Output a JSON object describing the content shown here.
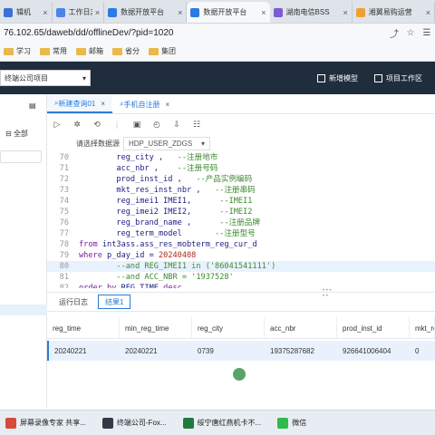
{
  "browser": {
    "tabs": [
      {
        "label": "辑机",
        "color": "#3a6fd8",
        "active": false
      },
      {
        "label": "工作日志",
        "color": "#4a86e8",
        "active": false
      },
      {
        "label": "数据开放平台",
        "color": "#2c7be5",
        "active": false
      },
      {
        "label": "数据开放平台",
        "color": "#2c7be5",
        "active": true
      },
      {
        "label": "湖南电信BSS",
        "color": "#7b5cd6",
        "active": false
      },
      {
        "label": "湘翼易购运营",
        "color": "#f0a030",
        "active": false
      }
    ],
    "address": "76.102.65/daweb/dd/offlineDev/?pid=1020",
    "bookmarks": [
      "学习",
      "常用",
      "邮箱",
      "省分",
      "集团"
    ]
  },
  "app": {
    "project_select": "终端公司项目",
    "new_model_label": "新增模型",
    "project_workspace_label": "项目工作区"
  },
  "left_panel": {
    "all_label": "全部"
  },
  "editor_tabs": [
    {
      "label": "新建查询01",
      "active": true
    },
    {
      "label": "手机自注册",
      "active": false
    }
  ],
  "datasource": {
    "label": "请选择数据源",
    "value": "HDP_USER_ZDGS"
  },
  "code": [
    {
      "n": "70",
      "segs": [
        [
          "",
          "        reg_city ,   "
        ],
        [
          "cm",
          "--注册地市"
        ]
      ]
    },
    {
      "n": "71",
      "segs": [
        [
          "",
          "        acc_nbr ,    "
        ],
        [
          "cm",
          "--注册号码"
        ]
      ]
    },
    {
      "n": "72",
      "segs": [
        [
          "",
          "        prod_inst_id ,   "
        ],
        [
          "cm",
          "--产品实例编码"
        ]
      ]
    },
    {
      "n": "73",
      "segs": [
        [
          "",
          "        mkt_res_inst_nbr ,   "
        ],
        [
          "cm",
          "--注册串码"
        ]
      ]
    },
    {
      "n": "74",
      "segs": [
        [
          "",
          "        reg_imei1 IMEI1,      "
        ],
        [
          "cm",
          "--IMEI1"
        ]
      ]
    },
    {
      "n": "75",
      "segs": [
        [
          "",
          "        reg_imei2 IMEI2,      "
        ],
        [
          "cm",
          "--IMEI2"
        ]
      ]
    },
    {
      "n": "76",
      "segs": [
        [
          "",
          "        reg_brand_name ,      "
        ],
        [
          "cm",
          "--注册品牌"
        ]
      ]
    },
    {
      "n": "77",
      "segs": [
        [
          "",
          "        reg_term_model       "
        ],
        [
          "cm",
          "--注册型号"
        ]
      ]
    },
    {
      "n": "78",
      "segs": [
        [
          "kw",
          "from "
        ],
        [
          "",
          "int3ass.ass_res_mobterm_reg_cur_d"
        ]
      ]
    },
    {
      "n": "79",
      "segs": [
        [
          "kw",
          "where "
        ],
        [
          "",
          "p_day_id = "
        ],
        [
          "st",
          "20240408"
        ]
      ]
    },
    {
      "n": "80",
      "segs": [
        [
          "cm",
          "        --and REG_IMEI1 in ('86041541111')"
        ]
      ],
      "hl": true
    },
    {
      "n": "81",
      "segs": [
        [
          "cm",
          "        --and ACC_NBR = '1937528'"
        ]
      ]
    },
    {
      "n": "82",
      "segs": [
        [
          "kw",
          "order by "
        ],
        [
          "",
          "REG_TIME "
        ],
        [
          "kw",
          "desc"
        ]
      ]
    }
  ],
  "results": {
    "tabs": [
      {
        "label": "运行日志",
        "active": false
      },
      {
        "label": "结果1",
        "active": true
      }
    ],
    "columns": [
      "reg_time",
      "min_reg_time",
      "reg_city",
      "acc_nbr",
      "prod_inst_id",
      "mkt_re"
    ],
    "rows": [
      [
        "20240221",
        "20240221",
        "0739",
        "19375287682",
        "926641006404",
        "0"
      ]
    ]
  },
  "taskbar": [
    {
      "label": "屏幕录像专家 共享...",
      "color": "#d94a38"
    },
    {
      "label": "终端公司-Fox...",
      "color": "#333a45"
    },
    {
      "label": "绥宁唐红燕机卡不...",
      "color": "#1f7a3f"
    },
    {
      "label": "微信",
      "color": "#2dbb4a"
    }
  ]
}
